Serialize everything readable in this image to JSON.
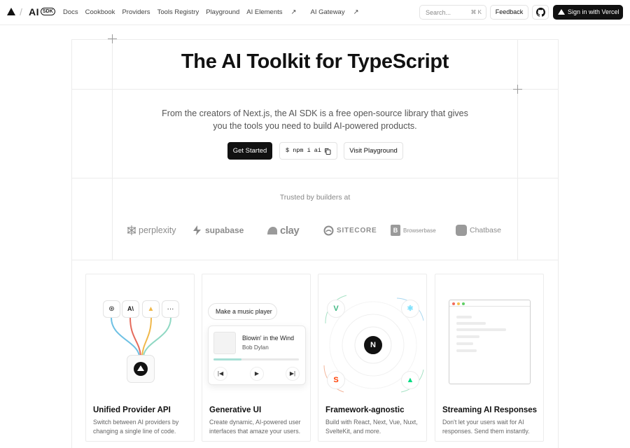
{
  "nav": {
    "brand": "AI",
    "brand_badge": "SDK",
    "links": [
      "Docs",
      "Cookbook",
      "Providers",
      "Tools Registry",
      "Playground",
      "AI Elements",
      "AI Gateway"
    ],
    "search_placeholder": "Search...",
    "search_shortcut": "⌘ K",
    "feedback_label": "Feedback",
    "signin_label": "Sign in with Vercel"
  },
  "hero": {
    "title": "The AI Toolkit for TypeScript",
    "subtitle": "From the creators of Next.js, the AI SDK is a free open-source library that gives you the tools you need to build AI-powered products.",
    "get_started_label": "Get Started",
    "npm_command": "$ npm i ai",
    "playground_label": "Visit Playground"
  },
  "trusted": {
    "heading": "Trusted by builders at",
    "logos": [
      "perplexity",
      "supabase",
      "clay",
      "SITECORE",
      "Browserbase",
      "Chatbase"
    ]
  },
  "cards": [
    {
      "title": "Unified Provider API",
      "desc": "Switch between AI providers by changing a single line of code."
    },
    {
      "title": "Generative UI",
      "desc": "Create dynamic, AI-powered user interfaces that amaze your users."
    },
    {
      "title": "Framework-agnostic",
      "desc": "Build with React, Next, Vue, Nuxt, SvelteKit, and more."
    },
    {
      "title": "Streaming AI Responses",
      "desc": "Don't let your users wait for AI responses. Send them instantly."
    }
  ],
  "provider_chips": [
    "openai-icon",
    "anthropic-icon",
    "mistral-icon",
    "more-icon"
  ],
  "provider_more": "···",
  "genui": {
    "prompt": "Make a music player",
    "song": "Blowin' in the Wind",
    "artist": "Bob Dylan",
    "progress": 0.33
  },
  "framework_hub": "N",
  "colors": {
    "accent": "#111111",
    "border": "#ececec",
    "progress": "#a7dfd5"
  }
}
